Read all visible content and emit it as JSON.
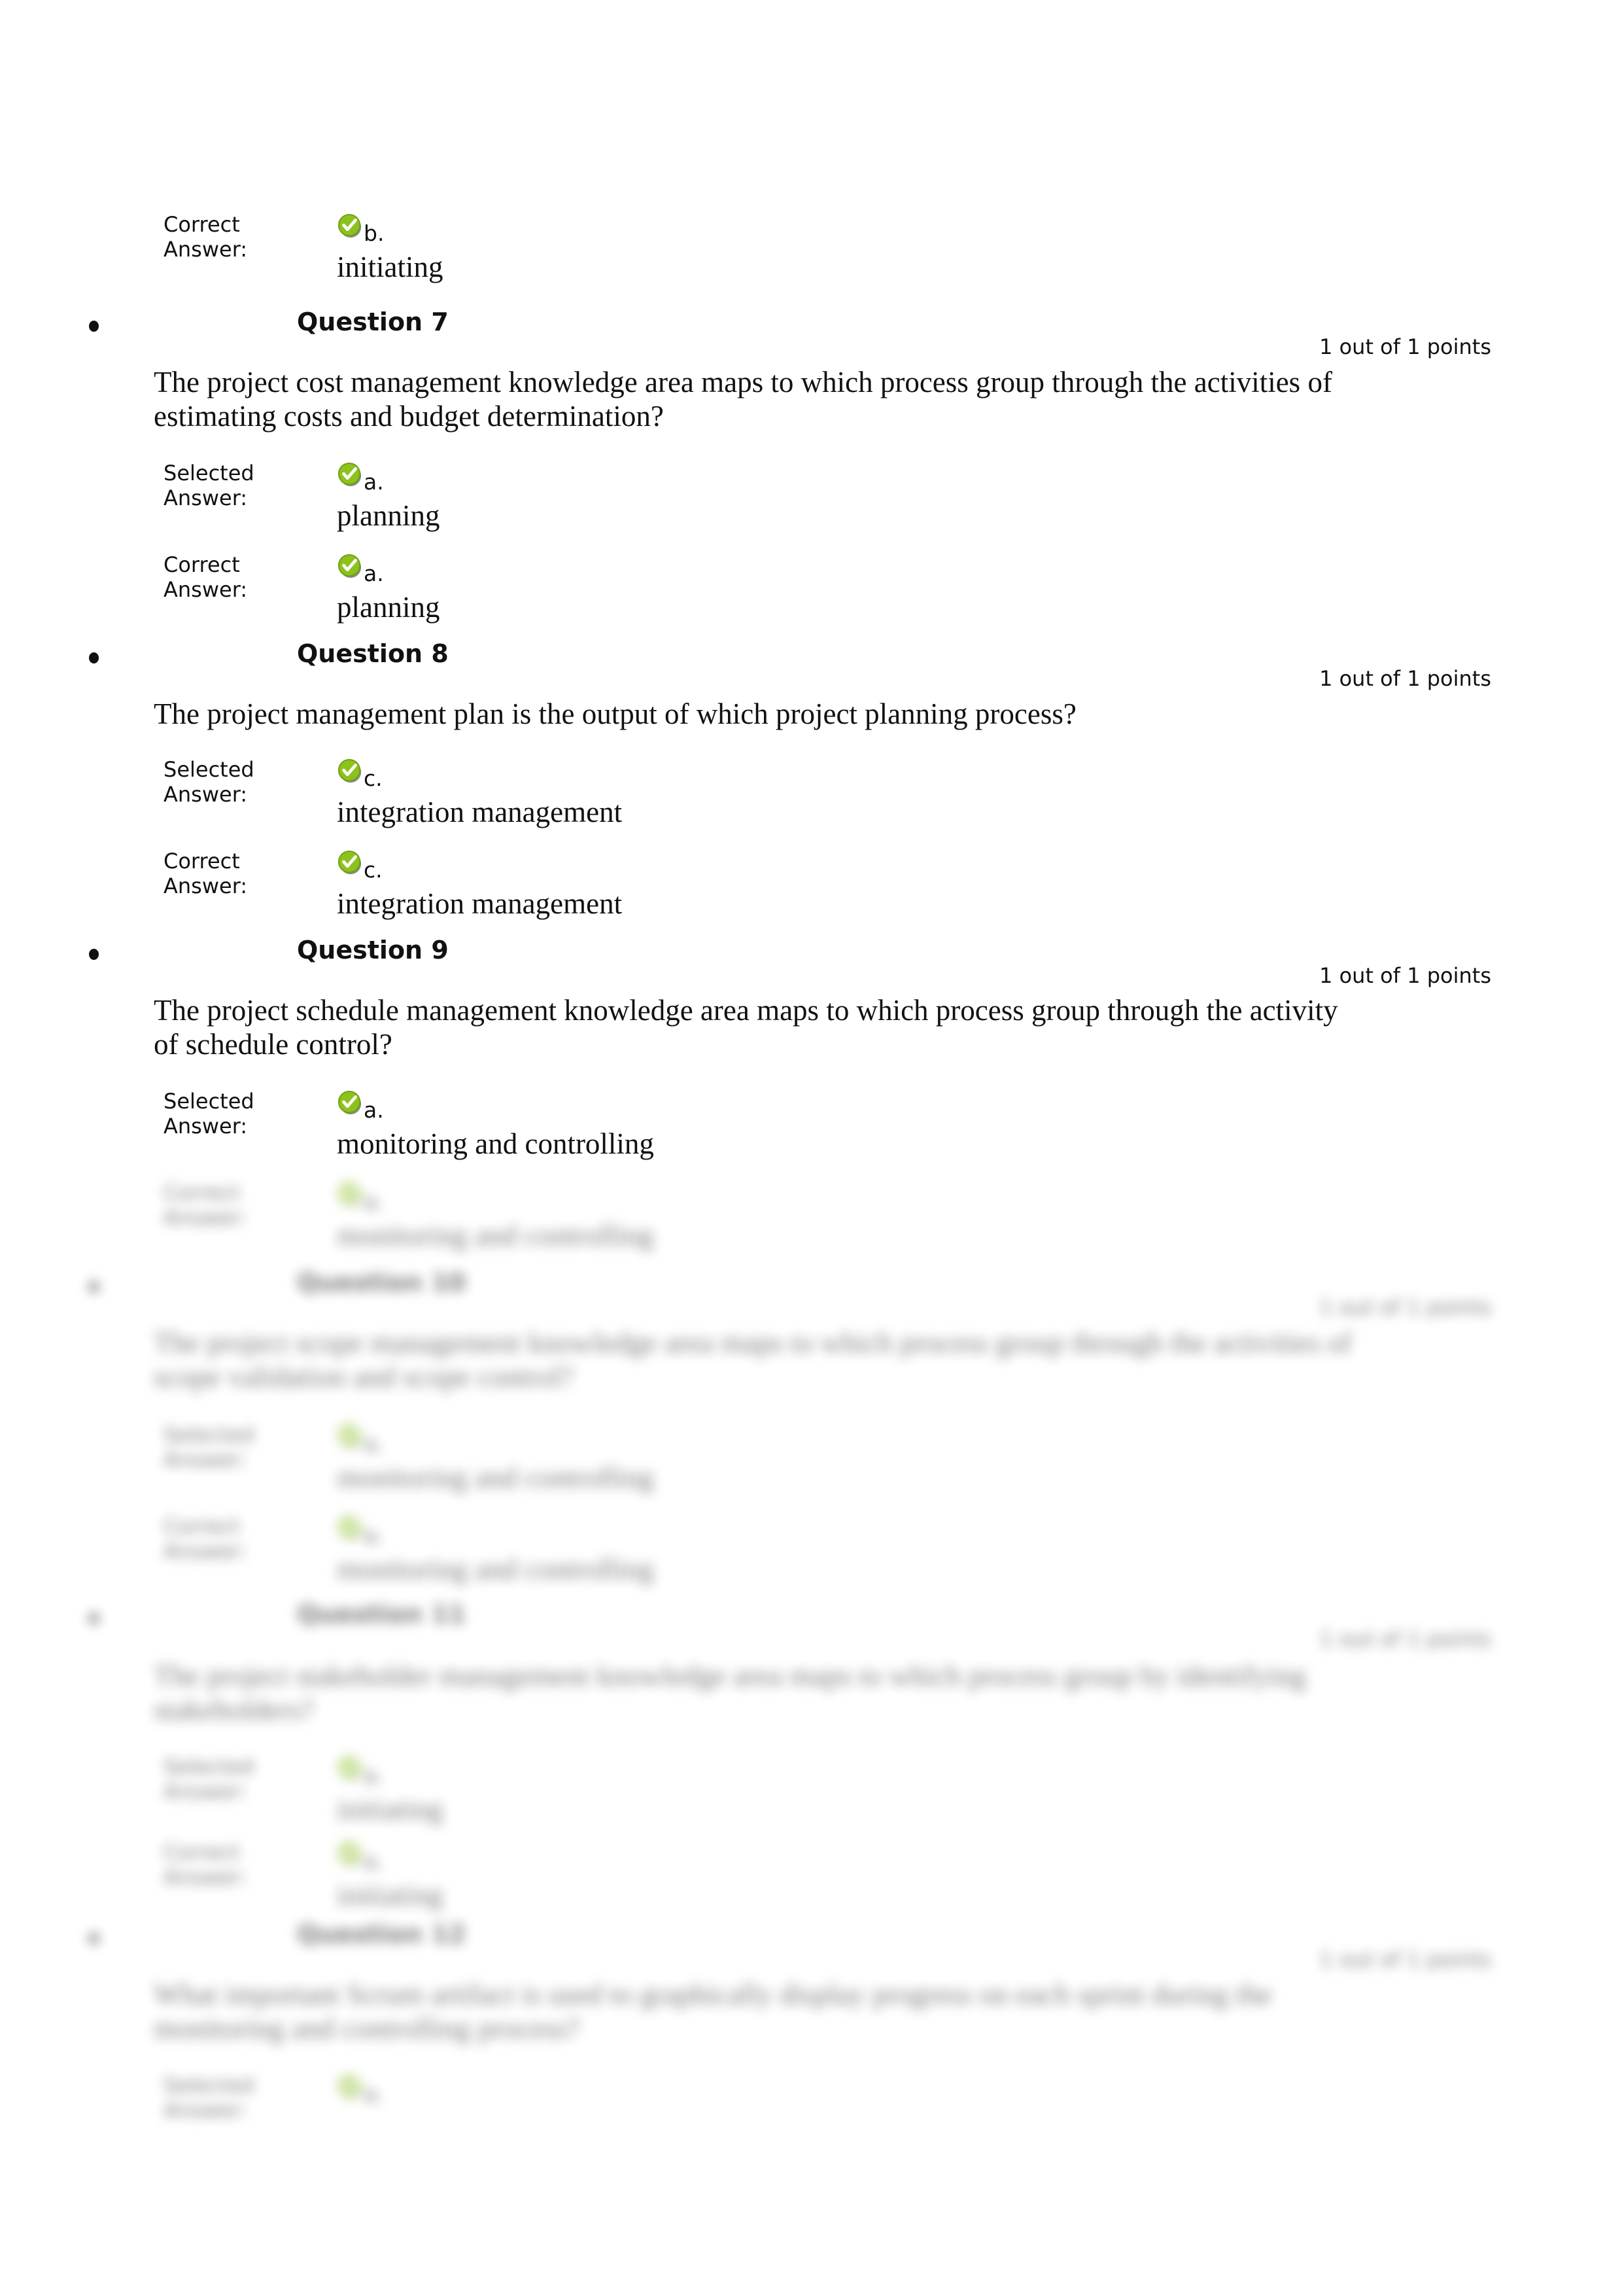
{
  "colors": {
    "check_green": "#8cc21b",
    "check_shadow": "#8a8a8a",
    "text": "#111111"
  },
  "labels": {
    "selected": [
      "Selected",
      "Answer:"
    ],
    "correct": [
      "Correct",
      "Answer:"
    ]
  },
  "top_fragment": {
    "correct_letter": "b.",
    "correct_text": "initiating"
  },
  "questions": [
    {
      "title": "Question 7",
      "points": "1 out of 1 points",
      "text": "The project cost management knowledge area maps to which process group through the activities of estimating costs and budget determination?",
      "selected_letter": "a.",
      "selected_text": "planning",
      "correct_letter": "a.",
      "correct_text": "planning"
    },
    {
      "title": "Question 8",
      "points": "1 out of 1 points",
      "text": "The project management plan is the output of which project planning process?",
      "selected_letter": "c.",
      "selected_text": "integration management",
      "correct_letter": "c.",
      "correct_text": "integration management"
    },
    {
      "title": "Question 9",
      "points": "1 out of 1 points",
      "text": "The project schedule management knowledge area maps to which process group through the activity of schedule control?",
      "selected_letter": "a.",
      "selected_text": "monitoring and controlling",
      "correct_letter": "a.",
      "correct_text": "monitoring and controlling"
    },
    {
      "title": "Question 10",
      "points": "1 out of 1 points",
      "text": "The project scope management knowledge area maps to which process group through the activities of scope validation and scope control?",
      "selected_letter": "a.",
      "selected_text": "monitoring and controlling",
      "correct_letter": "a.",
      "correct_text": "monitoring and controlling"
    },
    {
      "title": "Question 11",
      "points": "1 out of 1 points",
      "text": "The project stakeholder management knowledge area maps to which process group by identifying stakeholders?",
      "selected_letter": "a.",
      "selected_text": "initiating",
      "correct_letter": "a.",
      "correct_text": "initiating"
    },
    {
      "title": "Question 12",
      "points": "1 out of 1 points",
      "text": "What important Scrum artifact is used to graphically display progress on each sprint during the monitoring and controlling process?",
      "selected_letter": "a."
    }
  ]
}
